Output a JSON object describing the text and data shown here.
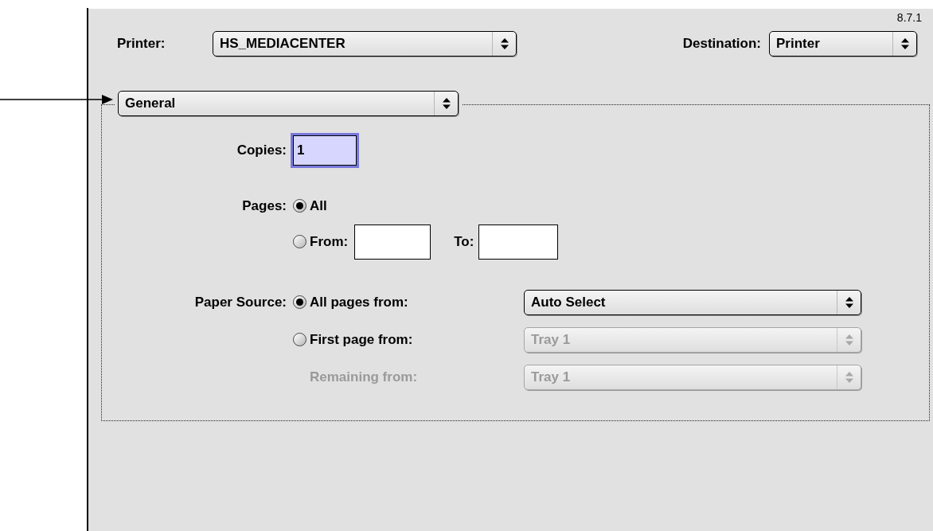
{
  "version": "8.7.1",
  "printer": {
    "label": "Printer:",
    "value": "HS_MEDIACENTER"
  },
  "destination": {
    "label": "Destination:",
    "value": "Printer"
  },
  "panel_menu": {
    "value": "General"
  },
  "copies": {
    "label": "Copies:",
    "value": "1",
    "focused": true
  },
  "pages": {
    "label": "Pages:",
    "to_label": "To:",
    "options": [
      {
        "label": "All",
        "selected": true
      },
      {
        "label": "From:",
        "selected": false
      }
    ]
  },
  "paper_source": {
    "label": "Paper Source:",
    "rows": [
      {
        "kind": "radio",
        "label": "All pages from:",
        "value": "Auto Select",
        "selected": true,
        "disabled": false
      },
      {
        "kind": "radio",
        "label": "First page from:",
        "value": "Tray 1",
        "selected": false,
        "disabled": true
      },
      {
        "kind": "plain",
        "label": "Remaining from:",
        "value": "Tray 1",
        "disabled": true
      }
    ]
  }
}
